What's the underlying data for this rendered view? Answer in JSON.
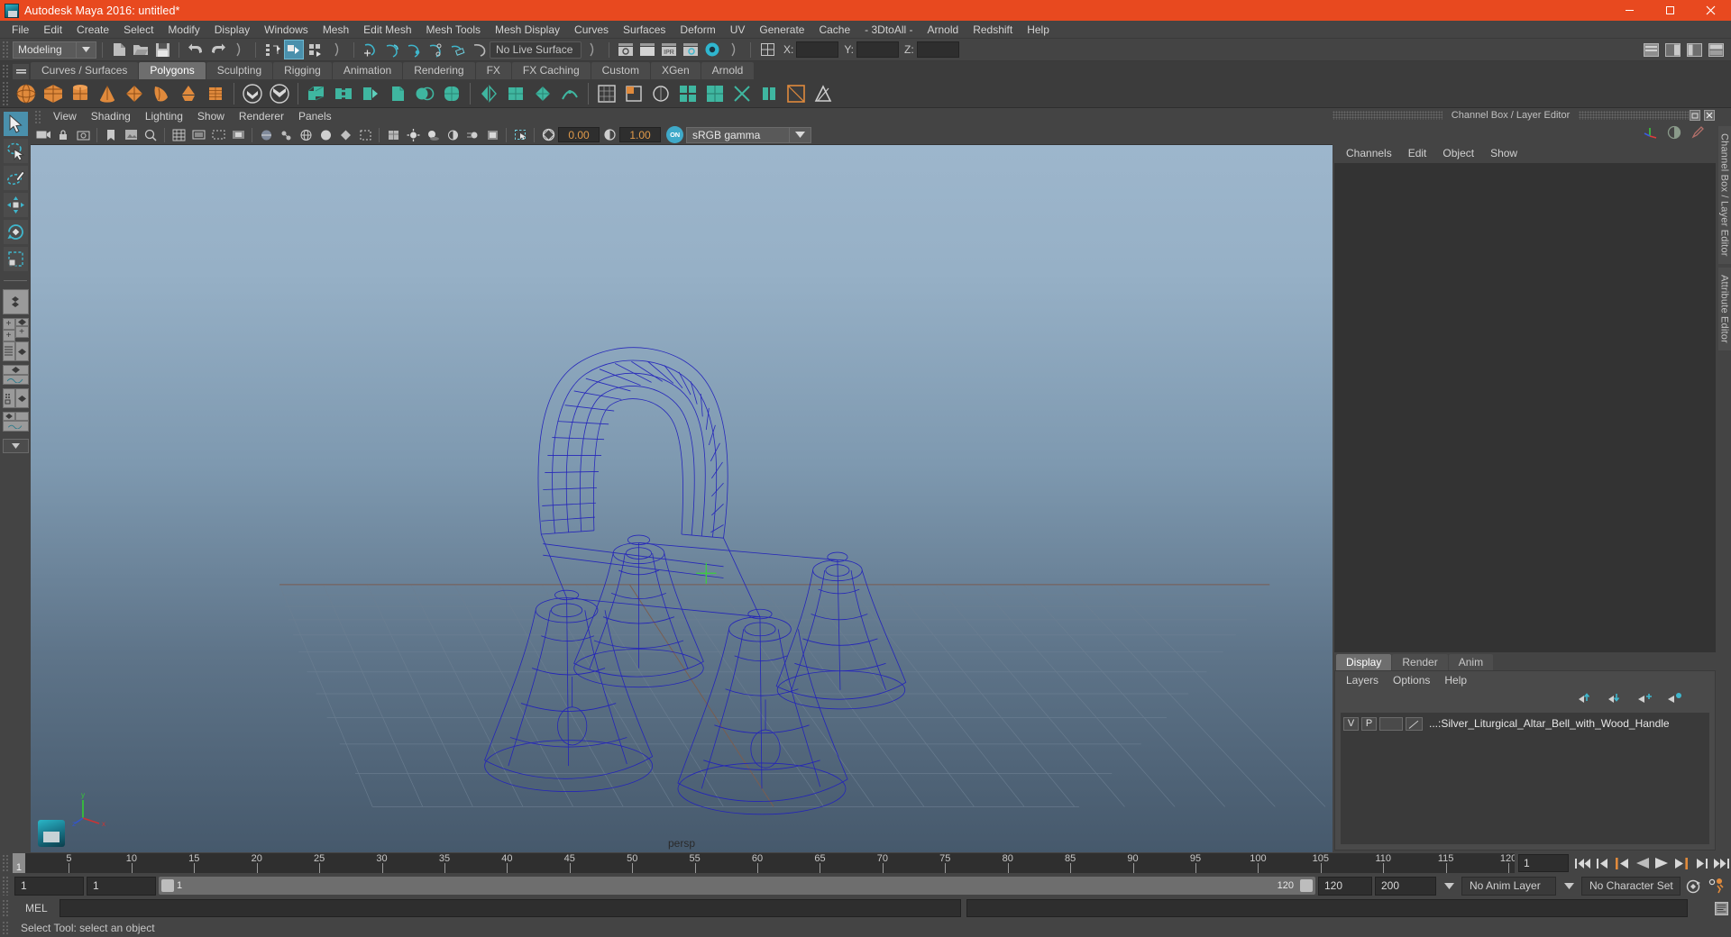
{
  "titlebar": {
    "title": "Autodesk Maya 2016: untitled*",
    "app_icon": "maya-icon",
    "minimize": "minimize-icon",
    "maximize": "maximize-icon",
    "close": "close-icon"
  },
  "menubar": {
    "items": [
      {
        "label": "File"
      },
      {
        "label": "Edit"
      },
      {
        "label": "Create"
      },
      {
        "label": "Select"
      },
      {
        "label": "Modify"
      },
      {
        "label": "Display"
      },
      {
        "label": "Windows"
      },
      {
        "label": "Mesh"
      },
      {
        "label": "Edit Mesh"
      },
      {
        "label": "Mesh Tools"
      },
      {
        "label": "Mesh Display"
      },
      {
        "label": "Curves"
      },
      {
        "label": "Surfaces"
      },
      {
        "label": "Deform"
      },
      {
        "label": "UV"
      },
      {
        "label": "Generate"
      },
      {
        "label": "Cache"
      },
      {
        "label": "- 3DtoAll -"
      },
      {
        "label": "Arnold"
      },
      {
        "label": "Redshift"
      },
      {
        "label": "Help"
      }
    ]
  },
  "statusline": {
    "menu_set": "Modeling",
    "live_surface": "No Live Surface",
    "coord_labels": [
      "X:",
      "Y:",
      "Z:"
    ],
    "coord_values": [
      "",
      "",
      ""
    ],
    "selection_mask_icons": [
      "select-hierarchy-icon",
      "select-object-icon",
      "select-component-icon"
    ],
    "snap_icons": [
      "snap-to-grid-icon",
      "snap-to-curve-icon",
      "snap-to-point-icon",
      "snap-to-projected-center-icon",
      "snap-to-view-plane-icon",
      "make-live-icon"
    ],
    "render_icons": [
      "render-current-frame-icon",
      "render-sequence-icon",
      "ipr-render-icon",
      "render-settings-icon",
      "hypershade-icon"
    ],
    "editor_icons": [
      "open-editor-icon",
      "toggle-sidebar-icon",
      "show-attribute-editor-icon",
      "show-tool-settings-icon",
      "show-channel-box-icon"
    ]
  },
  "shelf": {
    "tabs": [
      {
        "label": "Curves / Surfaces",
        "active": false
      },
      {
        "label": "Polygons",
        "active": true
      },
      {
        "label": "Sculpting",
        "active": false
      },
      {
        "label": "Rigging",
        "active": false
      },
      {
        "label": "Animation",
        "active": false
      },
      {
        "label": "Rendering",
        "active": false
      },
      {
        "label": "FX",
        "active": false
      },
      {
        "label": "FX Caching",
        "active": false
      },
      {
        "label": "Custom",
        "active": false
      },
      {
        "label": "XGen",
        "active": false
      },
      {
        "label": "Arnold",
        "active": false
      }
    ],
    "icons": [
      "poly-sphere-icon",
      "poly-cube-icon",
      "poly-cylinder-icon",
      "poly-cone-icon",
      "poly-torus-icon",
      "poly-plane-icon",
      "poly-disc-icon",
      "poly-platonic-icon",
      "poly-pyramid-icon",
      "poly-prism-icon",
      "poly-combine-icon",
      "poly-separate-icon",
      "poly-extrude-icon",
      "poly-bridge-icon",
      "poly-append-icon",
      "poly-bevel-icon",
      "poly-booleans-icon",
      "poly-smooth-icon",
      "poly-mirror-icon",
      "poly-reduce-icon",
      "poly-quadrangulate-icon",
      "poly-triangulate-icon",
      "poly-crease-icon",
      "poly-multi-cut-icon",
      "uv-planar-icon",
      "uv-cylindrical-icon",
      "uv-spherical-icon",
      "uv-automatic-icon",
      "uv-layout-icon",
      "uv-cut-icon",
      "uv-sew-icon",
      "uv-unfold-icon",
      "uv-editor-icon"
    ]
  },
  "toolbox": {
    "tools": [
      {
        "name": "select-tool",
        "selected": true
      },
      {
        "name": "lasso-select-tool",
        "selected": false
      },
      {
        "name": "paint-selection-tool",
        "selected": false
      },
      {
        "name": "move-tool",
        "selected": false
      },
      {
        "name": "rotate-tool",
        "selected": false
      },
      {
        "name": "scale-tool",
        "selected": false
      }
    ],
    "layouts": [
      {
        "name": "single-perspective-layout"
      },
      {
        "name": "four-view-layout"
      },
      {
        "name": "outliner-persp-layout"
      },
      {
        "name": "persp-graph-layout"
      },
      {
        "name": "hypershade-persp-layout"
      },
      {
        "name": "persp-graph-outliner-layout"
      }
    ],
    "more_arrow": "chevron-down-icon"
  },
  "viewport": {
    "panel_menu": [
      {
        "label": "View"
      },
      {
        "label": "Shading"
      },
      {
        "label": "Lighting"
      },
      {
        "label": "Show"
      },
      {
        "label": "Renderer"
      },
      {
        "label": "Panels"
      }
    ],
    "toolbar": {
      "exposure_value": "0.00",
      "gamma_value": "1.00",
      "color_management_toggle": "ON",
      "view_transform": "sRGB gamma",
      "view_transform_dropdown": "chevron-down-icon",
      "icons": [
        "select-camera-icon",
        "lock-camera-icon",
        "camera-attributes-icon",
        "bookmark-icon",
        "image-plane-icon",
        "two-d-pan-zoom-icon",
        "grid-toggle-icon",
        "film-gate-icon",
        "resolution-gate-icon",
        "gate-mask-icon",
        "xray-toggle-icon",
        "xray-joints-icon",
        "wireframe-toggle-icon",
        "smooth-shade-all-icon",
        "flat-shade-icon",
        "bounding-box-icon",
        "textured-toggle-icon",
        "lighting-toggle-icon",
        "shadows-toggle-icon",
        "screen-space-ao-icon",
        "motion-blur-icon",
        "multisample-icon",
        "isolate-select-icon",
        "exposure-icon",
        "gamma-icon"
      ]
    },
    "camera_label": "persp",
    "axis_labels": {
      "x": "x",
      "y": "y",
      "z": "z"
    },
    "model_name": "Silver_Liturgical_Altar_Bell_with_Wood_Handle",
    "wireframe_color": "#2222bb",
    "grid_color": "#6b7b8c"
  },
  "channel_box": {
    "panel_title": "Channel Box / Layer Editor",
    "undock_icon": "undock-icon",
    "close_icon": "close-icon",
    "header_icons": [
      "axis-tripod-icon",
      "contrast-icon",
      "pencil-icon"
    ],
    "menu": [
      {
        "label": "Channels"
      },
      {
        "label": "Edit"
      },
      {
        "label": "Object"
      },
      {
        "label": "Show"
      }
    ]
  },
  "layer_editor": {
    "tabs": [
      {
        "label": "Display",
        "active": true
      },
      {
        "label": "Render",
        "active": false
      },
      {
        "label": "Anim",
        "active": false
      }
    ],
    "menu": [
      {
        "label": "Layers"
      },
      {
        "label": "Options"
      },
      {
        "label": "Help"
      }
    ],
    "buttons": [
      "move-layer-up-icon",
      "move-layer-down-icon",
      "new-layer-icon",
      "new-layer-from-selected-icon"
    ],
    "layers": [
      {
        "visibility": "V",
        "playback": "P",
        "type": "",
        "name": "...:Silver_Liturgical_Altar_Bell_with_Wood_Handle"
      }
    ]
  },
  "vertical_tabs": [
    {
      "label": "Channel Box / Layer Editor"
    },
    {
      "label": "Attribute Editor"
    }
  ],
  "time_slider": {
    "start": 1,
    "end": 120,
    "current_frame": "1",
    "tick_labels": [
      "5",
      "10",
      "15",
      "20",
      "25",
      "30",
      "35",
      "40",
      "45",
      "50",
      "55",
      "60",
      "65",
      "70",
      "75",
      "80",
      "85",
      "90",
      "95",
      "100",
      "105",
      "110",
      "115",
      "120"
    ],
    "cursor_label": "1",
    "playback_buttons": [
      "go-to-start-icon",
      "step-back-frame-icon",
      "step-back-key-icon",
      "play-backwards-icon",
      "play-forwards-icon",
      "step-forward-key-icon",
      "step-forward-frame-icon",
      "go-to-end-icon"
    ]
  },
  "range_slider": {
    "anim_start": "1",
    "range_start": "1",
    "bar_start_label": "1",
    "bar_end_label": "120",
    "range_end": "120",
    "anim_end": "200",
    "anim_layer": "No Anim Layer",
    "character_set": "No Character Set",
    "auto_key_icon": "auto-keyframe-icon",
    "anim_prefs_icon": "animation-preferences-icon"
  },
  "command_line": {
    "label": "MEL",
    "input_value": "",
    "output_value": "",
    "script_editor_icon": "script-editor-icon"
  },
  "help_line": {
    "text": "Select Tool: select an object"
  },
  "colors": {
    "title_bar": "#e8491f",
    "ui_bg": "#444444",
    "accent": "#4a90ac",
    "panel_dark": "#333333",
    "orange_text": "#e09a4a"
  }
}
